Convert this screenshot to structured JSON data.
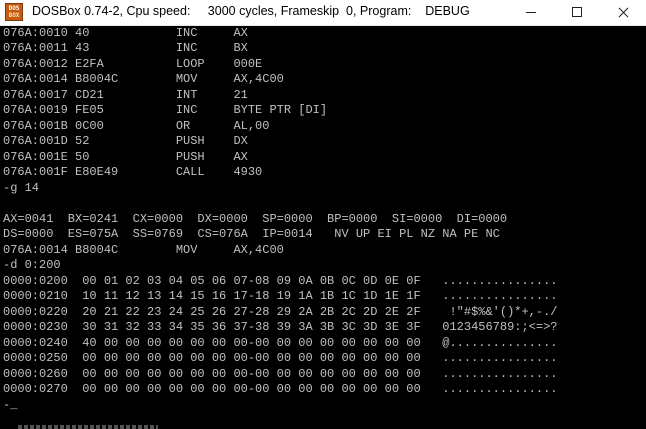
{
  "window": {
    "title": "DOSBox 0.74-2, Cpu speed:     3000 cycles, Frameskip  0, Program:    DEBUG",
    "icon_top": "DOS",
    "icon_bottom": "BOX",
    "minimize_icon": "minimize-icon",
    "maximize_icon": "maximize-icon",
    "close_icon": "close-icon"
  },
  "console": {
    "lines": [
      "076A:0010 40            INC     AX",
      "076A:0011 43            INC     BX",
      "076A:0012 E2FA          LOOP    000E",
      "076A:0014 B8004C        MOV     AX,4C00",
      "076A:0017 CD21          INT     21",
      "076A:0019 FE05          INC     BYTE PTR [DI]",
      "076A:001B 0C00          OR      AL,00",
      "076A:001D 52            PUSH    DX",
      "076A:001E 50            PUSH    AX",
      "076A:001F E80E49        CALL    4930",
      "-g 14",
      "",
      "AX=0041  BX=0241  CX=0000  DX=0000  SP=0000  BP=0000  SI=0000  DI=0000",
      "DS=0000  ES=075A  SS=0769  CS=076A  IP=0014   NV UP EI PL NZ NA PE NC",
      "076A:0014 B8004C        MOV     AX,4C00",
      "-d 0:200",
      "0000:0200  00 01 02 03 04 05 06 07-08 09 0A 0B 0C 0D 0E 0F   ................",
      "0000:0210  10 11 12 13 14 15 16 17-18 19 1A 1B 1C 1D 1E 1F   ................",
      "0000:0220  20 21 22 23 24 25 26 27-28 29 2A 2B 2C 2D 2E 2F    !\"#$%&'()*+,-./",
      "0000:0230  30 31 32 33 34 35 36 37-38 39 3A 3B 3C 3D 3E 3F   0123456789:;<=>?",
      "0000:0240  40 00 00 00 00 00 00 00-00 00 00 00 00 00 00 00   @...............",
      "0000:0250  00 00 00 00 00 00 00 00-00 00 00 00 00 00 00 00   ................",
      "0000:0260  00 00 00 00 00 00 00 00-00 00 00 00 00 00 00 00   ................",
      "0000:0270  00 00 00 00 00 00 00 00-00 00 00 00 00 00 00 00   ................",
      "-_"
    ]
  }
}
